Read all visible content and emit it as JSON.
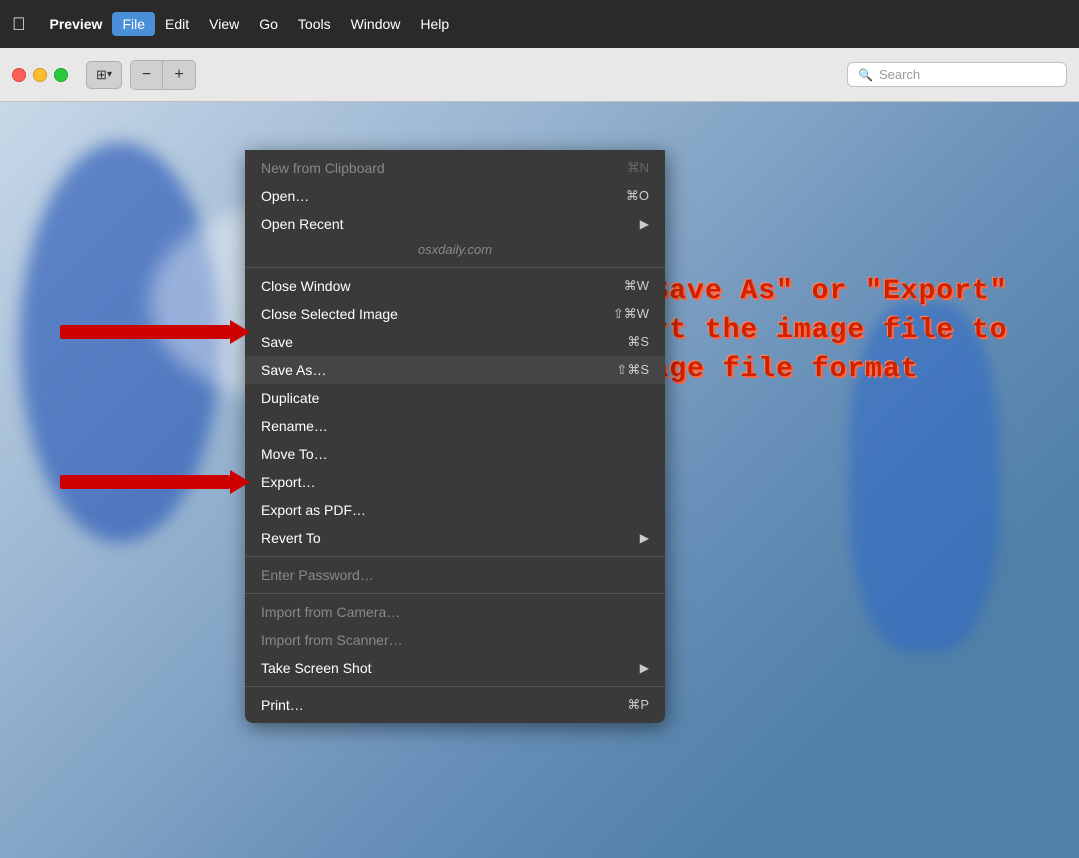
{
  "menubar": {
    "apple_icon": "🍎",
    "items": [
      {
        "id": "preview",
        "label": "Preview",
        "bold": true,
        "active": false
      },
      {
        "id": "file",
        "label": "File",
        "bold": false,
        "active": true
      },
      {
        "id": "edit",
        "label": "Edit",
        "bold": false,
        "active": false
      },
      {
        "id": "view",
        "label": "View",
        "bold": false,
        "active": false
      },
      {
        "id": "go",
        "label": "Go",
        "bold": false,
        "active": false
      },
      {
        "id": "tools",
        "label": "Tools",
        "bold": false,
        "active": false
      },
      {
        "id": "window",
        "label": "Window",
        "bold": false,
        "active": false
      },
      {
        "id": "help",
        "label": "Help",
        "bold": false,
        "active": false
      }
    ]
  },
  "toolbar": {
    "sidebar_toggle_icon": "▣",
    "zoom_out_label": "−",
    "zoom_in_label": "+",
    "search_placeholder": "Search"
  },
  "dropdown": {
    "items": [
      {
        "id": "new-from-clipboard",
        "label": "New from Clipboard",
        "shortcut": "⌘N",
        "disabled": true,
        "separator_after": false
      },
      {
        "id": "open",
        "label": "Open…",
        "shortcut": "⌘O",
        "disabled": false,
        "separator_after": false
      },
      {
        "id": "open-recent",
        "label": "Open Recent",
        "shortcut": "",
        "arrow": true,
        "disabled": false,
        "separator_after": false
      },
      {
        "id": "watermark",
        "label": "osxdaily.com",
        "is_watermark": true,
        "separator_after": false
      },
      {
        "id": "close-window",
        "label": "Close Window",
        "shortcut": "⌘W",
        "disabled": false,
        "separator_after": false
      },
      {
        "id": "close-selected-image",
        "label": "Close Selected Image",
        "shortcut": "⇧⌘W",
        "disabled": false,
        "separator_after": false
      },
      {
        "id": "save",
        "label": "Save",
        "shortcut": "⌘S",
        "disabled": false,
        "separator_after": false
      },
      {
        "id": "save-as",
        "label": "Save As…",
        "shortcut": "⇧⌘S",
        "disabled": false,
        "highlighted": false,
        "separator_after": false
      },
      {
        "id": "duplicate",
        "label": "Duplicate",
        "shortcut": "",
        "disabled": false,
        "separator_after": false
      },
      {
        "id": "rename",
        "label": "Rename…",
        "shortcut": "",
        "disabled": false,
        "separator_after": false
      },
      {
        "id": "move-to",
        "label": "Move To…",
        "shortcut": "",
        "disabled": false,
        "separator_after": false
      },
      {
        "id": "export",
        "label": "Export…",
        "shortcut": "",
        "disabled": false,
        "highlighted": false,
        "separator_after": false
      },
      {
        "id": "export-pdf",
        "label": "Export as PDF…",
        "shortcut": "",
        "disabled": false,
        "separator_after": false
      },
      {
        "id": "revert-to",
        "label": "Revert To",
        "shortcut": "",
        "arrow": true,
        "disabled": false,
        "separator_after": true
      },
      {
        "id": "enter-password",
        "label": "Enter Password…",
        "shortcut": "",
        "disabled": true,
        "separator_after": true
      },
      {
        "id": "import-camera",
        "label": "Import from Camera…",
        "shortcut": "",
        "disabled": true,
        "separator_after": false
      },
      {
        "id": "import-scanner",
        "label": "Import from Scanner…",
        "shortcut": "",
        "disabled": true,
        "separator_after": false
      },
      {
        "id": "take-screenshot",
        "label": "Take Screen Shot",
        "shortcut": "",
        "arrow": true,
        "disabled": false,
        "separator_after": true
      },
      {
        "id": "print",
        "label": "Print…",
        "shortcut": "⌘P",
        "disabled": false,
        "separator_after": false
      }
    ]
  },
  "annotation": {
    "line1": "Choose \"Save As\" or \"Export\"",
    "line2": "to convert the image file to",
    "line3": "a new image file format"
  },
  "colors": {
    "annotation_text": "#cc2200",
    "menu_bg": "#3a3a3a",
    "menu_highlight": "#4a90d9",
    "arrow_color": "#cc0000",
    "menubar_bg": "#2a2a2a"
  }
}
